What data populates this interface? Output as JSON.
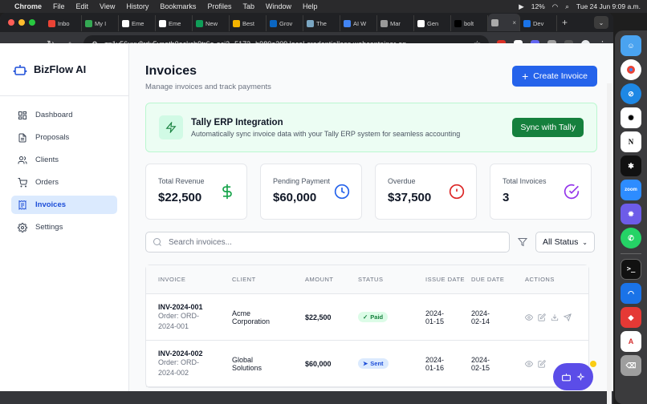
{
  "menubar": {
    "app": "Chrome",
    "items": [
      "File",
      "Edit",
      "View",
      "History",
      "Bookmarks",
      "Profiles",
      "Tab",
      "Window",
      "Help"
    ],
    "battery": "12%",
    "clock": "Tue 24 Jun  9:09 a.m."
  },
  "browser": {
    "tabs": [
      {
        "label": "Inbo",
        "color": "#ea4335"
      },
      {
        "label": "My I",
        "color": "#34a853"
      },
      {
        "label": "Eme",
        "color": "#ffffff"
      },
      {
        "label": "Eme",
        "color": "#ffffff"
      },
      {
        "label": "New",
        "color": "#0f9d58"
      },
      {
        "label": "Best",
        "color": "#f4b400"
      },
      {
        "label": "Grov",
        "color": "#0a66c2"
      },
      {
        "label": "The",
        "color": "#7aa6c2"
      },
      {
        "label": "AI W",
        "color": "#4285f4"
      },
      {
        "label": "Mar",
        "color": "#999999"
      },
      {
        "label": "Gen",
        "color": "#ffffff"
      },
      {
        "label": "bolt",
        "color": "#000000"
      },
      {
        "label": "",
        "color": "#aaaaaa"
      },
      {
        "label": "Dev",
        "color": "#1a73e8"
      }
    ],
    "url": "zp1v56uxy8rdx5ypatb0ockcb9tr6a-oci3--5173--b980e309.local-credentialless.webcontainer-ap..."
  },
  "app": {
    "brand": "BizFlow AI",
    "nav": [
      "Dashboard",
      "Proposals",
      "Clients",
      "Orders",
      "Invoices",
      "Settings"
    ],
    "active_nav": "Invoices"
  },
  "header": {
    "title": "Invoices",
    "subtitle": "Manage invoices and track payments",
    "create_label": "Create Invoice"
  },
  "tally": {
    "title": "Tally ERP Integration",
    "description": "Automatically sync invoice data with your Tally ERP system for seamless accounting",
    "button": "Sync with Tally"
  },
  "stats": [
    {
      "label": "Total Revenue",
      "value": "$22,500",
      "icon": "dollar-icon",
      "color": "#16a34a"
    },
    {
      "label": "Pending Payment",
      "value": "$60,000",
      "icon": "clock-icon",
      "color": "#2563eb"
    },
    {
      "label": "Overdue",
      "value": "$37,500",
      "icon": "alert-circle-icon",
      "color": "#dc2626"
    },
    {
      "label": "Total Invoices",
      "value": "3",
      "icon": "check-circle-icon",
      "color": "#9333ea"
    }
  ],
  "filters": {
    "search_placeholder": "Search invoices...",
    "status_value": "All Status"
  },
  "table": {
    "headers": [
      "INVOICE",
      "CLIENT",
      "AMOUNT",
      "STATUS",
      "ISSUE DATE",
      "DUE DATE",
      "ACTIONS"
    ],
    "rows": [
      {
        "invoice": "INV-2024-001",
        "order_prefix": "Order: ORD-",
        "order_suffix": "2024-001",
        "client_line1": "Acme",
        "client_line2": "Corporation",
        "amount": "$22,500",
        "status": "Paid",
        "issue_line1": "2024-",
        "issue_line2": "01-15",
        "due_line1": "2024-",
        "due_line2": "02-14"
      },
      {
        "invoice": "INV-2024-002",
        "order_prefix": "Order: ORD-",
        "order_suffix": "2024-002",
        "client_line1": "Global",
        "client_line2": "Solutions",
        "amount": "$60,000",
        "status": "Sent",
        "issue_line1": "2024-",
        "issue_line2": "01-16",
        "due_line1": "2024-",
        "due_line2": "02-15"
      }
    ]
  },
  "colors": {
    "accent": "#2563eb",
    "sync_green": "#15803d",
    "fab": "#5b4de8"
  }
}
